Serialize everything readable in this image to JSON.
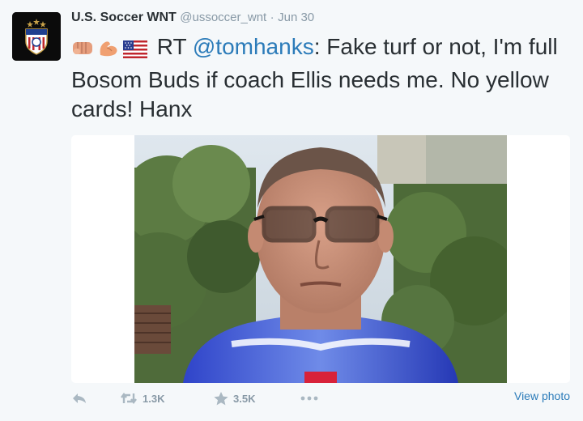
{
  "tweet": {
    "display_name": "U.S. Soccer WNT",
    "handle": "@ussoccer_wnt",
    "separator": "·",
    "timestamp": "Jun 30",
    "emojis": [
      "fist-emoji",
      "flexed-bicep-emoji",
      "us-flag-emoji"
    ],
    "text_prefix": " RT ",
    "mention": "@tomhanks",
    "text_body": ": Fake turf or not, I'm full Bosom Buds if coach Ellis needs me. No yellow cards!  Hanx",
    "view_photo_label": "View photo"
  },
  "actions": {
    "retweet_count": "1.3K",
    "favorite_count": "3.5K"
  },
  "colors": {
    "link": "#2b7bb9",
    "muted": "#8899a6",
    "text": "#292f33",
    "background": "#f5f8fa"
  }
}
